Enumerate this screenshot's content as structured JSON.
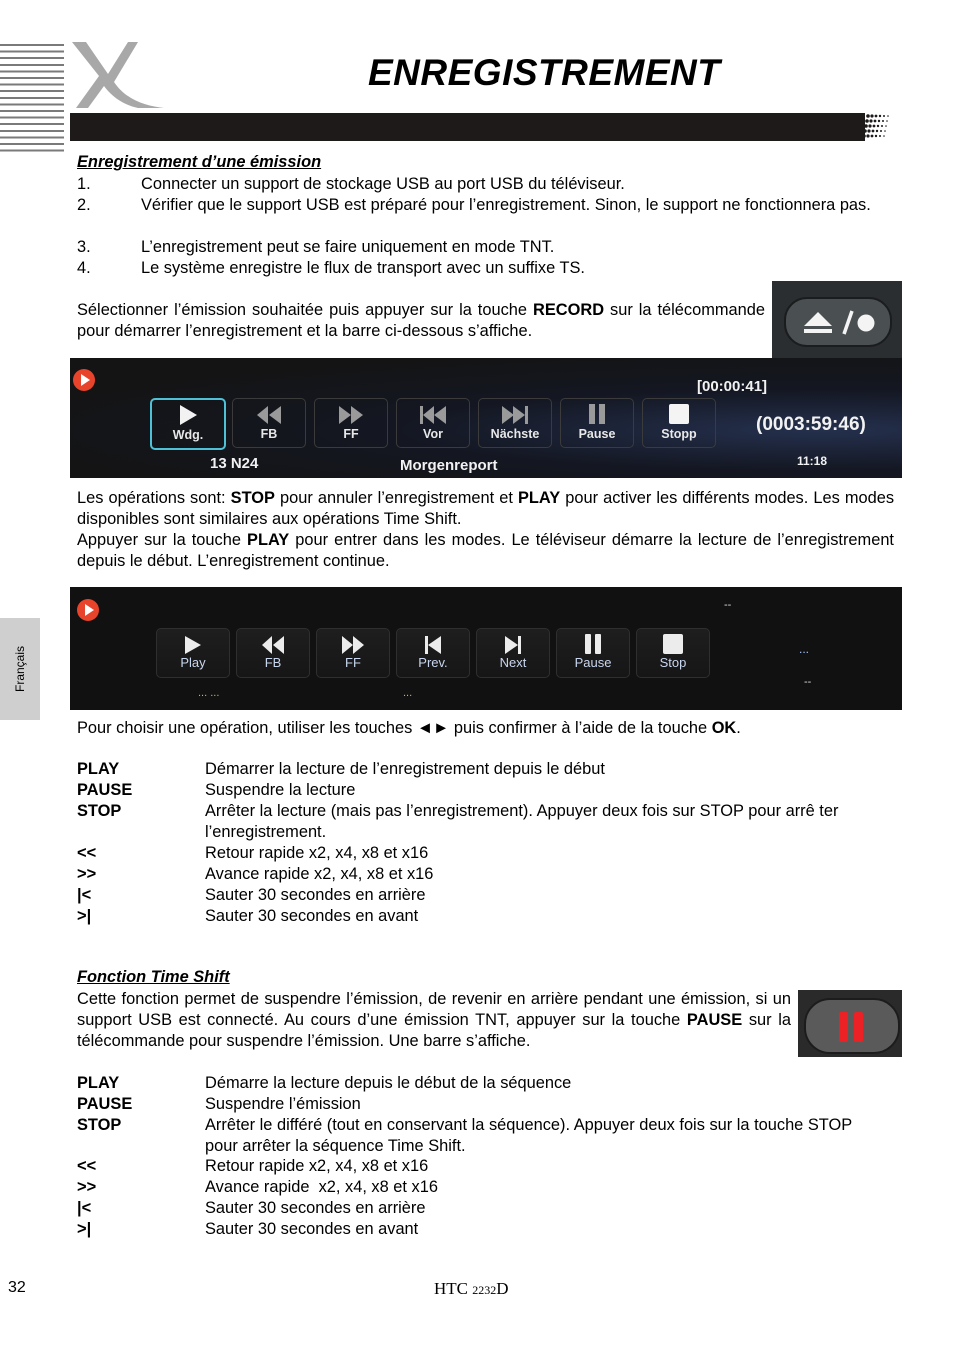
{
  "header": {
    "title": "ENREGISTREMENT",
    "brand_icon": "x-logo-icon"
  },
  "side_tab": {
    "label": "Français"
  },
  "section1": {
    "heading": "Enregistrement d’une émission",
    "steps": [
      {
        "num": "1.",
        "text": "Connecter un support de stockage USB au port USB du téléviseur."
      },
      {
        "num": "2.",
        "text": "Vérifier que le support USB est préparé pour l’enregistrement. Sinon, le support ne fonctionnera pas."
      },
      {
        "num": "3.",
        "text": "L’enregistrement peut se faire uniquement en mode TNT."
      },
      {
        "num": "4.",
        "text": "Le système enregistre le flux de transport avec un suffixe TS."
      }
    ],
    "record_para": {
      "before": "Sélectionner l’émission souhaitée puis appuyer sur la touche ",
      "bold": "RECORD",
      "after": " sur la télécommande pour démarrer l’enregistrement et la barre ci-dessous s’affiche."
    },
    "remote_icon": "eject-record-button-icon"
  },
  "screen1": {
    "buttons": [
      {
        "label": "Wdg.",
        "icon": "play-icon",
        "active": true
      },
      {
        "label": "FB",
        "icon": "rewind-icon"
      },
      {
        "label": "FF",
        "icon": "fast-forward-icon"
      },
      {
        "label": "Vor",
        "icon": "skip-back-icon"
      },
      {
        "label": "Nächste",
        "icon": "skip-forward-icon"
      },
      {
        "label": "Pause",
        "icon": "pause-icon"
      },
      {
        "label": "Stopp",
        "icon": "stop-icon"
      }
    ],
    "channel": "13 N24",
    "program": "Morgenreport",
    "elapsed": "[00:00:41]",
    "remaining": "(0003:59:46)",
    "clock": "11:18"
  },
  "para_ops": {
    "line1_a": "Les opérations sont: ",
    "line1_b": "STOP",
    "line1_c": " pour annuler l’enregistrement et ",
    "line1_d": "PLAY",
    "line1_e": " pour activer les différents modes. Les modes disponibles sont similaires aux opérations Time Shift.",
    "line2_a": "Appuyer sur la touche ",
    "line2_b": "PLAY",
    "line2_c": " pour entrer dans les modes. Le téléviseur démarre la lecture de l’enregistrement depuis le début. L’enregistrement continue."
  },
  "screen2": {
    "buttons": [
      {
        "label": "Play",
        "icon": "play-icon"
      },
      {
        "label": "FB",
        "icon": "rewind-icon"
      },
      {
        "label": "FF",
        "icon": "fast-forward-icon"
      },
      {
        "label": "Prev.",
        "icon": "skip-back-icon"
      },
      {
        "label": "Next",
        "icon": "skip-forward-icon"
      },
      {
        "label": "Pause",
        "icon": "pause-icon"
      },
      {
        "label": "Stop",
        "icon": "stop-icon"
      }
    ],
    "placeholder_left": "... ...",
    "placeholder_mid": "...",
    "placeholder_top": "--",
    "placeholder_right": "...",
    "placeholder_bottom": "--"
  },
  "choose_para": {
    "a": "Pour choisir une opération, utiliser les touches ◄► puis confirmer à l’aide de la touche ",
    "b": "OK",
    "c": "."
  },
  "ops_record": [
    {
      "key": "PLAY",
      "desc": "Démarrer la lecture de l’enregistrement depuis le début"
    },
    {
      "key": "PAUSE",
      "desc": "Suspendre la lecture"
    },
    {
      "key": "STOP",
      "desc": "Arrêter la lecture (mais pas l’enregistrement). Appuyer deux fois sur STOP pour arrê ter l’enregistrement."
    },
    {
      "key": "<<",
      "desc": "Retour rapide x2, x4, x8 et x16"
    },
    {
      "key": ">>",
      "desc": "Avance rapide x2, x4, x8 et x16"
    },
    {
      "key": "|<",
      "desc": "Sauter 30 secondes en arrière"
    },
    {
      "key": ">|",
      "desc": "Sauter 30 secondes en avant"
    }
  ],
  "section2": {
    "heading": "Fonction Time Shift",
    "para_a": "Cette fonction permet de suspendre l’émission, de revenir en arrière pendant une émission, si un support USB est connecté. Au cours d’une émission TNT, appuyer sur la touche ",
    "para_b": "PAUSE",
    "para_c": " sur la télécommande pour suspendre l’émission. Une barre s’affiche.",
    "remote_icon": "pause-button-icon"
  },
  "ops_timeshift": [
    {
      "key": "PLAY",
      "desc": "Démarre la lecture depuis le début de la séquence"
    },
    {
      "key": "PAUSE",
      "desc": "Suspendre l’émission"
    },
    {
      "key": "STOP",
      "desc": "Arrêter le différé (tout en conservant la séquence). Appuyer deux fois sur la touche STOP pour arrêter la séquence Time Shift."
    },
    {
      "key": "<<",
      "desc": "Retour rapide x2, x4, x8 et x16"
    },
    {
      "key": ">>",
      "desc": "Avance rapide  x2, x4, x8 et x16"
    },
    {
      "key": "|<",
      "desc": "Sauter 30 secondes en arrière"
    },
    {
      "key": ">|",
      "desc": "Sauter 30 secondes en avant"
    }
  ],
  "footer": {
    "page_number": "32",
    "model_a": "HTC ",
    "model_b": "2232",
    "model_c": "D"
  }
}
